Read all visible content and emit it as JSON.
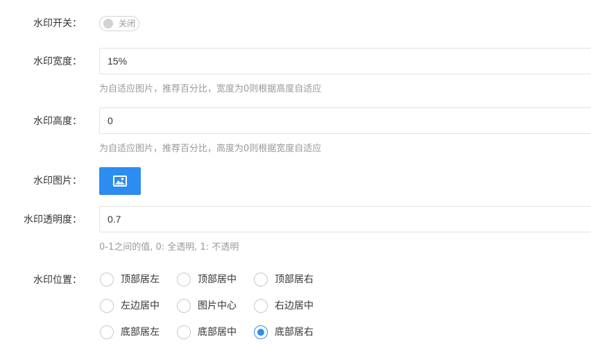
{
  "switch": {
    "label": "水印开关：",
    "state_text": "关闭",
    "checked": false
  },
  "width": {
    "label": "水印宽度：",
    "value": "15%",
    "hint": "为自适应图片，推荐百分比，宽度为0则根据高度自适应"
  },
  "height": {
    "label": "水印高度：",
    "value": "0",
    "hint": "为自适应图片，推荐百分比，高度为0则根据宽度自适应"
  },
  "image": {
    "label": "水印图片：",
    "icon": "image-icon"
  },
  "opacity": {
    "label": "水印透明度：",
    "value": "0.7",
    "hint": "0-1之间的值, 0: 全透明, 1: 不透明"
  },
  "position": {
    "label": "水印位置：",
    "options": [
      "顶部居左",
      "顶部居中",
      "顶部居右",
      "左边居中",
      "图片中心",
      "右边居中",
      "底部居左",
      "底部居中",
      "底部居右"
    ],
    "selected": "底部居右"
  },
  "colors": {
    "accent": "#2d8cf0",
    "hint": "#999999",
    "border": "#e2e2e2"
  }
}
